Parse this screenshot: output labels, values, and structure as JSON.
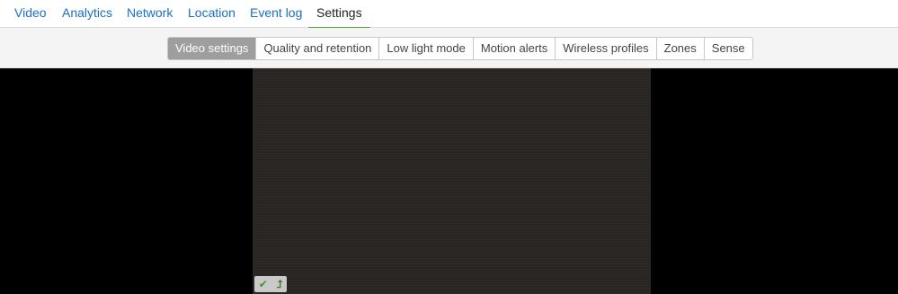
{
  "topnav": {
    "tabs": [
      {
        "label": "Video",
        "active": false
      },
      {
        "label": "Analytics",
        "active": false
      },
      {
        "label": "Network",
        "active": false
      },
      {
        "label": "Location",
        "active": false
      },
      {
        "label": "Event log",
        "active": false
      },
      {
        "label": "Settings",
        "active": true
      }
    ]
  },
  "subnav": {
    "segments": [
      {
        "label": "Video settings",
        "active": true
      },
      {
        "label": "Quality and retention",
        "active": false
      },
      {
        "label": "Low light mode",
        "active": false
      },
      {
        "label": "Motion alerts",
        "active": false
      },
      {
        "label": "Wireless profiles",
        "active": false
      },
      {
        "label": "Zones",
        "active": false
      },
      {
        "label": "Sense",
        "active": false
      }
    ]
  },
  "video": {
    "status_icons": [
      "check-icon",
      "upload-arrow-icon"
    ],
    "status_colors": {
      "check": "#3f9a2c",
      "arrow": "#4a7d2c"
    }
  },
  "colors": {
    "link": "#1a6fc4",
    "active_underline": "#5aa63a",
    "active_segment": "#9e9e9e"
  }
}
